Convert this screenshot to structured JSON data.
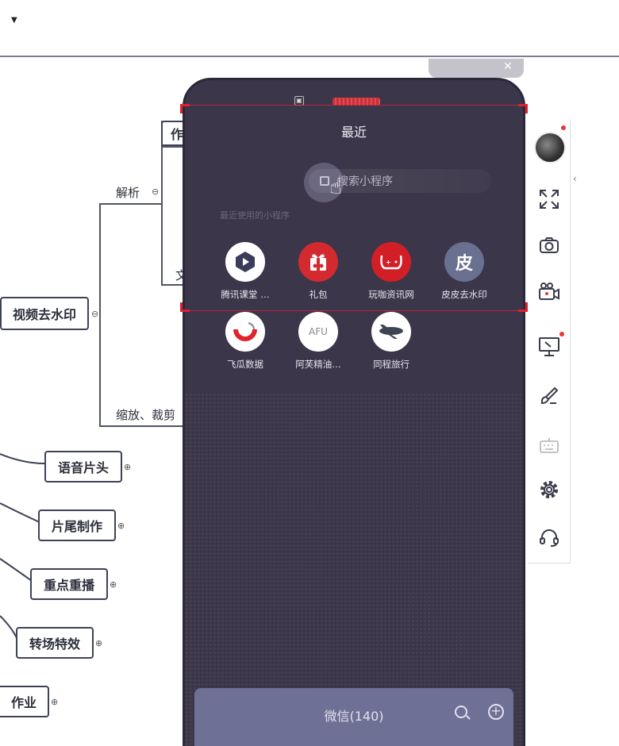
{
  "mindmap": {
    "root": "视频去水印",
    "branch_parse": "解析",
    "branch_zoom": "缩放、裁剪",
    "partial_1": "作",
    "partial_2": "文",
    "nodes": [
      "语音片头",
      "片尾制作",
      "重点重播",
      "转场特效",
      "作业"
    ]
  },
  "phone": {
    "title": "最近",
    "search_placeholder": "搜索小程序",
    "recent_label": "最近使用的小程序",
    "apps": [
      {
        "label": "腾讯课堂 …",
        "icon": "腾讯课堂",
        "color": "#ffffff",
        "fg": "#3b3c5a"
      },
      {
        "label": "礼包",
        "icon": "gift-icon",
        "color": "#d32a2f",
        "fg": "#ffffff"
      },
      {
        "label": "玩咖资讯网",
        "icon": "gamepad-icon",
        "color": "#d21f27",
        "fg": "#ffffff"
      },
      {
        "label": "皮皮去水印",
        "icon": "皮",
        "color": "#6a7090",
        "fg": "#ffffff"
      },
      {
        "label": "飞瓜数据",
        "icon": "melon-icon",
        "color": "#ffffff",
        "fg": "#e0232d"
      },
      {
        "label": "阿芙精油…",
        "icon": "AFU",
        "color": "#ffffff",
        "fg": "#888888"
      },
      {
        "label": "同程旅行",
        "icon": "plane-icon",
        "color": "#ffffff",
        "fg": "#444444"
      }
    ],
    "bottom_title": "微信(140)"
  },
  "toolbar": {
    "items": [
      "avatar",
      "fullscreen-icon",
      "camera-icon",
      "video-camera-icon",
      "screen-share-icon",
      "brush-icon",
      "keyboard-icon",
      "settings-icon",
      "headset-icon"
    ]
  }
}
